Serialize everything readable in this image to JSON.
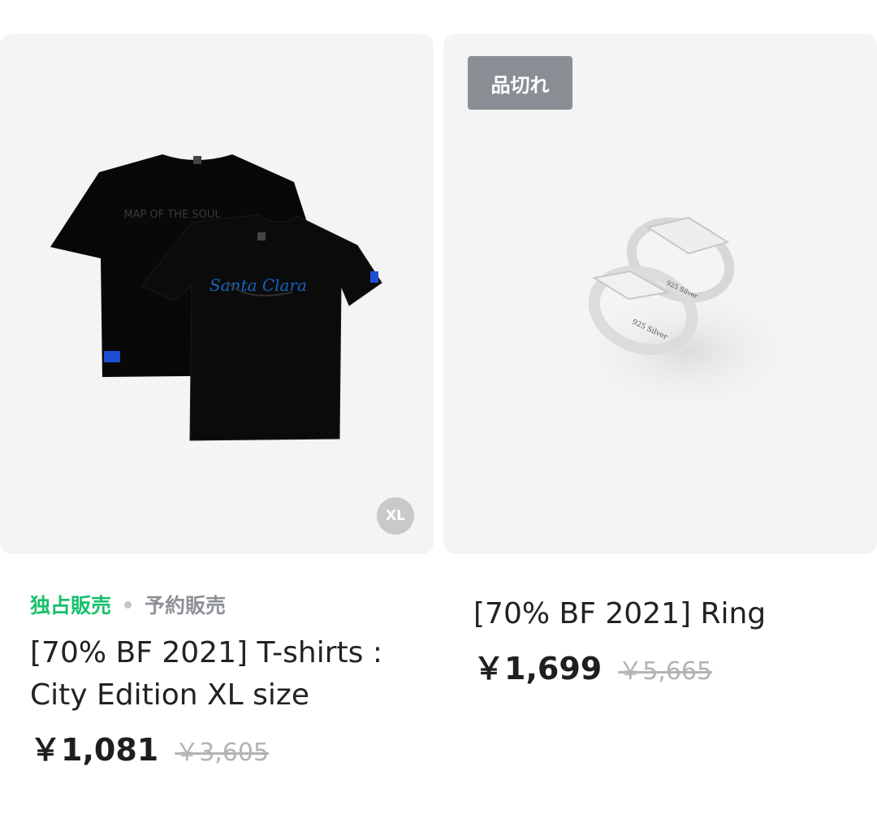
{
  "products": [
    {
      "size_badge": "XL",
      "tags": {
        "exclusive": "独占販売",
        "preorder": "予約販売"
      },
      "title": "[70% BF 2021] T-shirts : City Edition XL size",
      "price": "￥1,081",
      "original_price": "￥3,605",
      "image": {
        "shirt_print": "MAP OF THE SOUL",
        "shirt_script": "Santa Clara"
      },
      "colors": {
        "tag_exclusive": "#19c06c",
        "tag_preorder": "#8d9096"
      }
    },
    {
      "sold_out_badge": "品切れ",
      "title": "[70% BF 2021] Ring",
      "price": "￥1,699",
      "original_price": "￥5,665",
      "image": {
        "engraving_1": "925 Silver",
        "engraving_2": "925 Silver"
      }
    }
  ]
}
